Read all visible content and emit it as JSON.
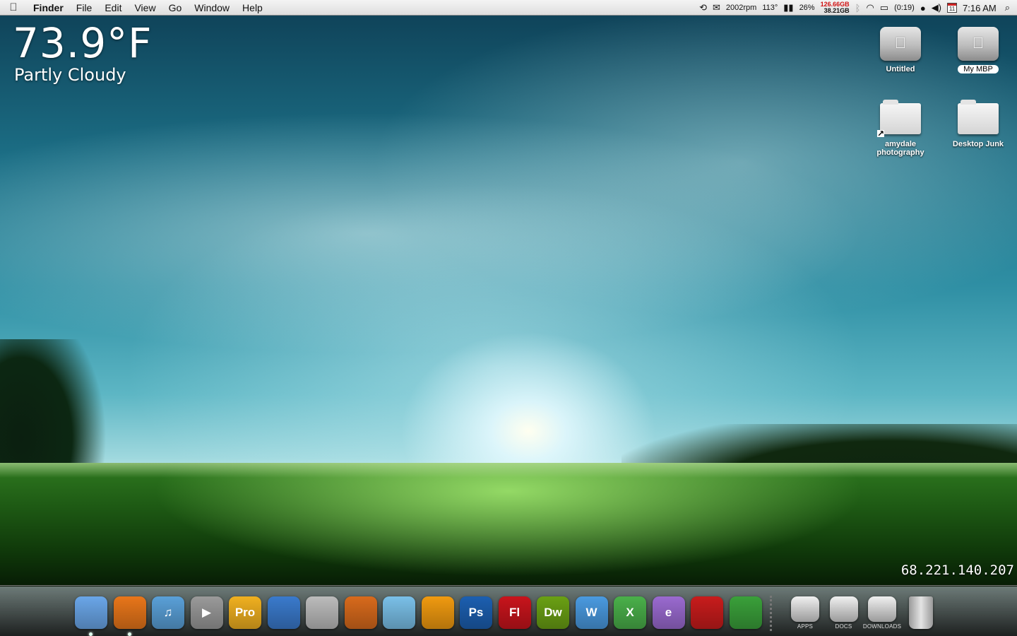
{
  "menubar": {
    "apple_glyph": "",
    "app_name": "Finder",
    "menus": [
      "File",
      "Edit",
      "View",
      "Go",
      "Window",
      "Help"
    ],
    "status": {
      "fan": "2002rpm",
      "temp": "113°",
      "cpu": "26%",
      "disk_used": "126.66GB",
      "disk_free": "38.21GB",
      "battery": "(0:19)",
      "calendar_day": "11",
      "clock": "7:16 AM"
    }
  },
  "weather": {
    "temperature": "73.9°F",
    "condition": "Partly Cloudy"
  },
  "desktop_icons": [
    {
      "label": "Untitled",
      "kind": "drive"
    },
    {
      "label": "My MBP",
      "kind": "drive"
    },
    {
      "label": "amydale photography",
      "kind": "folder-alias"
    },
    {
      "label": "Desktop Junk",
      "kind": "folder"
    }
  ],
  "ip_address": "68.221.140.207",
  "dock": {
    "apps": [
      {
        "name": "finder-icon",
        "text": "",
        "color": "#6aa6e8"
      },
      {
        "name": "firefox-icon",
        "text": "",
        "color": "#e8761a"
      },
      {
        "name": "itunes-icon",
        "text": "♫",
        "color": "#5aa0d8"
      },
      {
        "name": "video-player-icon",
        "text": "▶",
        "color": "#9a9a9a"
      },
      {
        "name": "pro-app-icon",
        "text": "Pro",
        "color": "#f0b020"
      },
      {
        "name": "cyberduck-icon",
        "text": "",
        "color": "#3a7acc"
      },
      {
        "name": "shield-app-icon",
        "text": "",
        "color": "#bcbcbc"
      },
      {
        "name": "reason-icon",
        "text": "",
        "color": "#d86a1c"
      },
      {
        "name": "mail-timer-icon",
        "text": "",
        "color": "#7ac0e8"
      },
      {
        "name": "runner-app-icon",
        "text": "",
        "color": "#f09a10"
      },
      {
        "name": "photoshop-icon",
        "text": "Ps",
        "color": "#1c5fb0"
      },
      {
        "name": "flash-icon",
        "text": "Fl",
        "color": "#c8141c"
      },
      {
        "name": "dreamweaver-icon",
        "text": "Dw",
        "color": "#6aa014"
      },
      {
        "name": "app-w-icon",
        "text": "W",
        "color": "#4a9ae0"
      },
      {
        "name": "app-x-icon",
        "text": "X",
        "color": "#4ab04a"
      },
      {
        "name": "app-e-icon",
        "text": "e",
        "color": "#9a6ad0"
      },
      {
        "name": "santa-app-icon",
        "text": "",
        "color": "#c81c1c"
      },
      {
        "name": "sims-icon",
        "text": "",
        "color": "#3aa03a"
      }
    ],
    "stacks": [
      {
        "name": "apps-stack-icon",
        "label": "APPS"
      },
      {
        "name": "docs-stack-icon",
        "label": "DOCS"
      },
      {
        "name": "downloads-stack-icon",
        "label": "DOWNLOADS"
      }
    ]
  }
}
